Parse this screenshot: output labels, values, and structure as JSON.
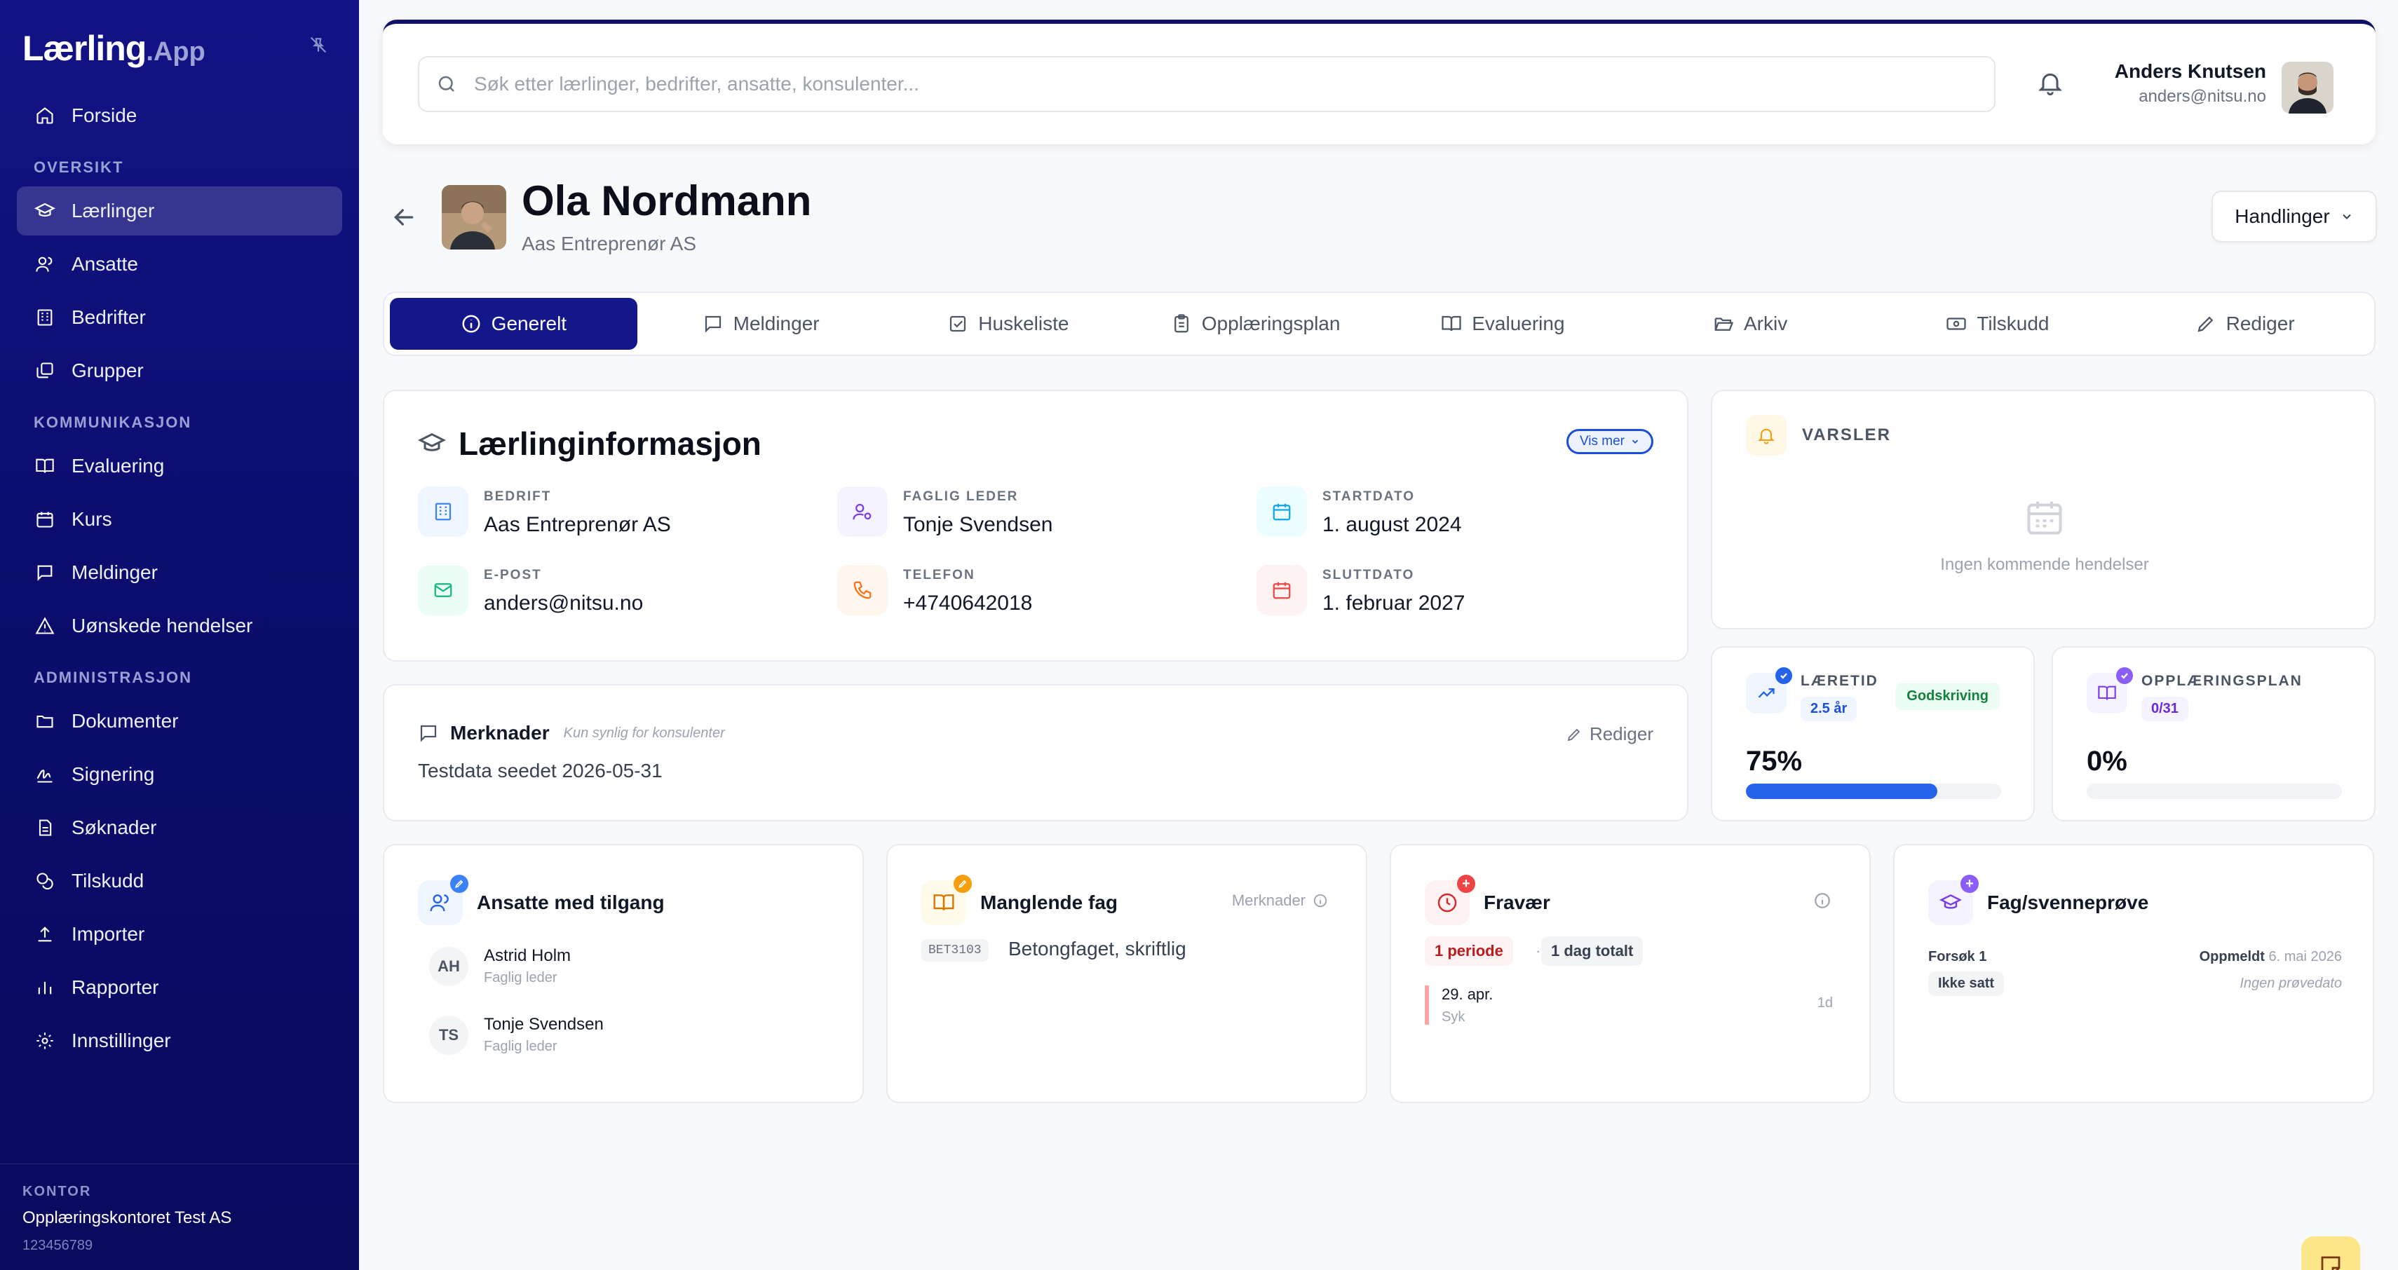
{
  "app": {
    "logo_main": "Lærling",
    "logo_suffix": ".App"
  },
  "sidebar": {
    "items": [
      {
        "label": "Forside",
        "icon": "home-icon"
      },
      {
        "section": "OVERSIKT"
      },
      {
        "label": "Lærlinger",
        "icon": "graduation-cap-icon",
        "active": true
      },
      {
        "label": "Ansatte",
        "icon": "users-icon"
      },
      {
        "label": "Bedrifter",
        "icon": "building-icon"
      },
      {
        "label": "Grupper",
        "icon": "layers-icon"
      },
      {
        "section": "KOMMUNIKASJON"
      },
      {
        "label": "Evaluering",
        "icon": "book-open-icon"
      },
      {
        "label": "Kurs",
        "icon": "calendar-icon"
      },
      {
        "label": "Meldinger",
        "icon": "message-icon"
      },
      {
        "label": "Uønskede hendelser",
        "icon": "warning-icon"
      },
      {
        "section": "ADMINISTRASJON"
      },
      {
        "label": "Dokumenter",
        "icon": "folder-icon"
      },
      {
        "label": "Signering",
        "icon": "signature-icon"
      },
      {
        "label": "Søknader",
        "icon": "document-icon"
      },
      {
        "label": "Tilskudd",
        "icon": "coins-icon"
      },
      {
        "label": "Importer",
        "icon": "upload-icon"
      },
      {
        "label": "Rapporter",
        "icon": "bar-chart-icon"
      },
      {
        "label": "Innstillinger",
        "icon": "gear-icon"
      }
    ],
    "footer": {
      "label": "KONTOR",
      "org": "Opplæringskontoret Test AS",
      "number": "123456789"
    }
  },
  "topbar": {
    "search_placeholder": "Søk etter lærlinger, bedrifter, ansatte, konsulenter...",
    "user_name": "Anders Knutsen",
    "user_email": "anders@nitsu.no"
  },
  "header": {
    "title": "Ola Nordmann",
    "subtitle": "Aas Entreprenør AS",
    "actions_label": "Handlinger"
  },
  "tabs": [
    {
      "label": "Generelt",
      "icon": "info-icon",
      "active": true
    },
    {
      "label": "Meldinger",
      "icon": "message-icon"
    },
    {
      "label": "Huskeliste",
      "icon": "checkbox-icon"
    },
    {
      "label": "Opplæringsplan",
      "icon": "clipboard-icon"
    },
    {
      "label": "Evaluering",
      "icon": "book-open-icon"
    },
    {
      "label": "Arkiv",
      "icon": "folder-open-icon"
    },
    {
      "label": "Tilskudd",
      "icon": "banknote-icon"
    },
    {
      "label": "Rediger",
      "icon": "pencil-icon"
    }
  ],
  "info": {
    "title": "Lærlinginformasjon",
    "show_more": "Vis mer",
    "fields": {
      "company": {
        "label": "BEDRIFT",
        "value": "Aas Entreprenør AS"
      },
      "leader": {
        "label": "FAGLIG LEDER",
        "value": "Tonje Svendsen"
      },
      "start": {
        "label": "STARTDATO",
        "value": "1. august 2024"
      },
      "email": {
        "label": "E-POST",
        "value": "anders@nitsu.no"
      },
      "phone": {
        "label": "TELEFON",
        "value": "+4740642018"
      },
      "end": {
        "label": "SLUTTDATO",
        "value": "1. februar 2027"
      }
    }
  },
  "notes": {
    "title": "Merknader",
    "subtitle": "Kun synlig for konsulenter",
    "edit_label": "Rediger",
    "text": "Testdata seedet 2026-05-31"
  },
  "alerts": {
    "title": "VARSLER",
    "empty": "Ingen kommende hendelser"
  },
  "stats": {
    "learning_time": {
      "label": "LÆRETID",
      "pill": "2.5 år",
      "badge": "Godskriving",
      "value": "75%",
      "progress": 0.75
    },
    "training_plan": {
      "label": "OPPLÆRINGSPLAN",
      "pill": "0/31",
      "value": "0%",
      "progress": 0.0
    }
  },
  "employees": {
    "title": "Ansatte med tilgang",
    "people": [
      {
        "initials": "AH",
        "name": "Astrid Holm",
        "role": "Faglig leder"
      },
      {
        "initials": "TS",
        "name": "Tonje Svendsen",
        "role": "Faglig leder"
      }
    ]
  },
  "missing": {
    "title": "Manglende fag",
    "notes_label": "Merknader",
    "code": "BET3103",
    "subject": "Betongfaget, skriftlig"
  },
  "absence": {
    "title": "Fravær",
    "periods": "1 periode",
    "separator": "·",
    "total": "1 dag totalt",
    "entry_date": "29. apr.",
    "entry_kind": "Syk",
    "entry_days": "1d"
  },
  "exam": {
    "title": "Fag/svenneprøve",
    "attempt": "Forsøk 1",
    "status": "Ikke satt",
    "registered_label": "Oppmeldt",
    "registered_date": "6. mai 2026",
    "no_date": "Ingen prøvedato"
  },
  "colors": {
    "sidebar": "#13158a",
    "primary": "#13178a",
    "accent_blue": "#2563eb"
  }
}
